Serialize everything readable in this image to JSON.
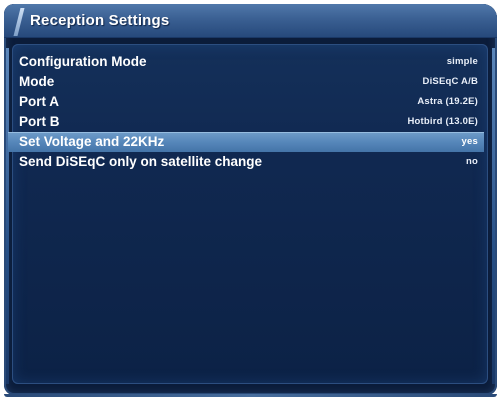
{
  "window": {
    "title": "Reception Settings"
  },
  "settings": {
    "items": [
      {
        "label": "Configuration Mode",
        "value": "simple",
        "selected": false
      },
      {
        "label": "Mode",
        "value": "DiSEqC A/B",
        "selected": false
      },
      {
        "label": "Port A",
        "value": "Astra (19.2E)",
        "selected": false
      },
      {
        "label": "Port B",
        "value": "Hotbird (13.0E)",
        "selected": false
      },
      {
        "label": "Set Voltage and 22KHz",
        "value": "yes",
        "selected": true
      },
      {
        "label": "Send DiSEqC only on satellite change",
        "value": "no",
        "selected": false
      }
    ]
  },
  "colors": {
    "background": "#0b1c3a",
    "title_bar": "#3a5f92",
    "selection": "#5687ba",
    "text": "#ffffff"
  }
}
